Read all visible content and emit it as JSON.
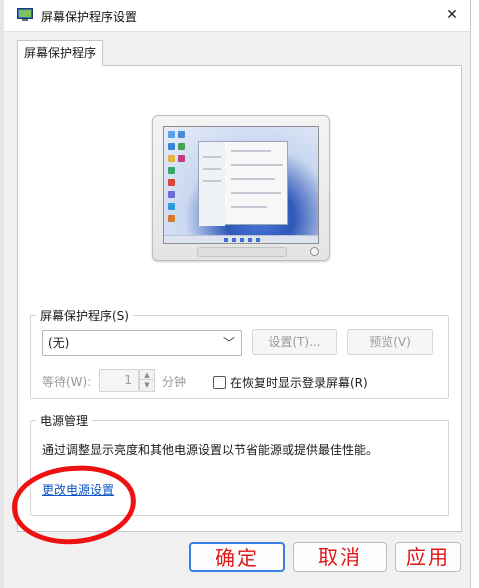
{
  "window": {
    "title": "屏幕保护程序设置",
    "close_glyph": "✕"
  },
  "tabs": [
    {
      "label": "屏幕保护程序"
    }
  ],
  "screensaver_group": {
    "legend": "屏幕保护程序(S)",
    "selected": "(无)",
    "settings_label": "设置(T)...",
    "preview_label": "预览(V)",
    "wait_label": "等待(W):",
    "wait_value": "1",
    "wait_unit": "分钟",
    "resume_label": "在恢复时显示登录屏幕(R)",
    "resume_checked": false
  },
  "power_group": {
    "legend": "电源管理",
    "description": "通过调整显示亮度和其他电源设置以节省能源或提供最佳性能。",
    "link_label": "更改电源设置"
  },
  "footer": {
    "ok_label": "确定",
    "cancel_label": "取消",
    "apply_label": "应用"
  },
  "icons": {
    "app": "screensaver-monitor-icon",
    "close": "close-icon",
    "dropdown": "chevron-down-icon"
  },
  "colors": {
    "link": "#0b54c8",
    "annotation": "#ee1111",
    "focus": "#3b7fe0"
  }
}
